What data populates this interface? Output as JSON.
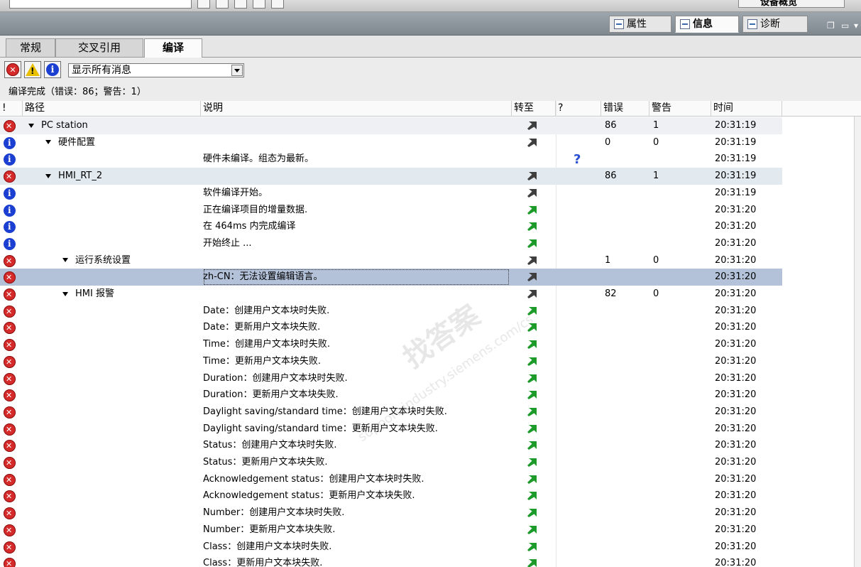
{
  "inspector": {
    "tabs": [
      {
        "label": "属性",
        "active": false
      },
      {
        "label": "信息",
        "active": true
      },
      {
        "label": "诊断",
        "active": false
      }
    ],
    "device_overview": "设备概览"
  },
  "subtabs": [
    {
      "label": "常规",
      "active": false
    },
    {
      "label": "交叉引用",
      "active": false
    },
    {
      "label": "编译",
      "active": true
    }
  ],
  "filter": {
    "selected": "显示所有消息"
  },
  "status": "编译完成（错误：86；警告：1）",
  "columns": {
    "bang": "!",
    "path": "路径",
    "description": "说明",
    "goto": "转至",
    "help": "?",
    "errors": "错误",
    "warnings": "警告",
    "time": "时间"
  },
  "rows": [
    {
      "sev": "error",
      "path": "PC station",
      "level": 1,
      "expand": true,
      "desc": "",
      "goto": "dark",
      "help": "",
      "errors": "86",
      "warnings": "1",
      "time": "20:31:19",
      "style": "lite"
    },
    {
      "sev": "info",
      "path": "硬件配置",
      "level": 2,
      "expand": true,
      "desc": "",
      "goto": "dark",
      "help": "",
      "errors": "0",
      "warnings": "0",
      "time": "20:31:19",
      "style": ""
    },
    {
      "sev": "info",
      "path": "",
      "level": 0,
      "expand": false,
      "desc": "硬件未编译。组态为最新。",
      "goto": "",
      "help": "?",
      "errors": "",
      "warnings": "",
      "time": "20:31:19",
      "style": ""
    },
    {
      "sev": "error",
      "path": "HMI_RT_2",
      "level": 2,
      "expand": true,
      "desc": "",
      "goto": "dark",
      "help": "",
      "errors": "86",
      "warnings": "1",
      "time": "20:31:19",
      "style": "hmi"
    },
    {
      "sev": "info",
      "path": "",
      "level": 0,
      "expand": false,
      "desc": "软件编译开始。",
      "goto": "dark",
      "help": "",
      "errors": "",
      "warnings": "",
      "time": "20:31:19",
      "style": ""
    },
    {
      "sev": "info",
      "path": "",
      "level": 0,
      "expand": false,
      "desc": "正在编译项目的增量数据.",
      "goto": "green",
      "help": "",
      "errors": "",
      "warnings": "",
      "time": "20:31:20",
      "style": ""
    },
    {
      "sev": "info",
      "path": "",
      "level": 0,
      "expand": false,
      "desc": "在 464ms 内完成编译",
      "goto": "green",
      "help": "",
      "errors": "",
      "warnings": "",
      "time": "20:31:20",
      "style": ""
    },
    {
      "sev": "info",
      "path": "",
      "level": 0,
      "expand": false,
      "desc": "开始终止 ...",
      "goto": "green",
      "help": "",
      "errors": "",
      "warnings": "",
      "time": "20:31:20",
      "style": ""
    },
    {
      "sev": "error",
      "path": "运行系统设置",
      "level": 3,
      "expand": true,
      "desc": "",
      "goto": "dark",
      "help": "",
      "errors": "1",
      "warnings": "0",
      "time": "20:31:20",
      "style": ""
    },
    {
      "sev": "error",
      "path": "",
      "level": 0,
      "expand": false,
      "desc": "zh-CN：无法设置编辑语言。",
      "goto": "dark",
      "help": "",
      "errors": "",
      "warnings": "",
      "time": "20:31:20",
      "style": "sel"
    },
    {
      "sev": "error",
      "path": "HMI 报警",
      "level": 3,
      "expand": true,
      "desc": "",
      "goto": "dark",
      "help": "",
      "errors": "82",
      "warnings": "0",
      "time": "20:31:20",
      "style": ""
    },
    {
      "sev": "error",
      "path": "",
      "level": 0,
      "expand": false,
      "desc": "Date：创建用户文本块时失败.",
      "goto": "green",
      "help": "",
      "errors": "",
      "warnings": "",
      "time": "20:31:20",
      "style": ""
    },
    {
      "sev": "error",
      "path": "",
      "level": 0,
      "expand": false,
      "desc": "Date：更新用户文本块失败.",
      "goto": "green",
      "help": "",
      "errors": "",
      "warnings": "",
      "time": "20:31:20",
      "style": ""
    },
    {
      "sev": "error",
      "path": "",
      "level": 0,
      "expand": false,
      "desc": "Time：创建用户文本块时失败.",
      "goto": "green",
      "help": "",
      "errors": "",
      "warnings": "",
      "time": "20:31:20",
      "style": ""
    },
    {
      "sev": "error",
      "path": "",
      "level": 0,
      "expand": false,
      "desc": "Time：更新用户文本块失败.",
      "goto": "green",
      "help": "",
      "errors": "",
      "warnings": "",
      "time": "20:31:20",
      "style": ""
    },
    {
      "sev": "error",
      "path": "",
      "level": 0,
      "expand": false,
      "desc": "Duration：创建用户文本块时失败.",
      "goto": "green",
      "help": "",
      "errors": "",
      "warnings": "",
      "time": "20:31:20",
      "style": ""
    },
    {
      "sev": "error",
      "path": "",
      "level": 0,
      "expand": false,
      "desc": "Duration：更新用户文本块失败.",
      "goto": "green",
      "help": "",
      "errors": "",
      "warnings": "",
      "time": "20:31:20",
      "style": ""
    },
    {
      "sev": "error",
      "path": "",
      "level": 0,
      "expand": false,
      "desc": "Daylight saving/standard time：创建用户文本块时失败.",
      "goto": "green",
      "help": "",
      "errors": "",
      "warnings": "",
      "time": "20:31:20",
      "style": ""
    },
    {
      "sev": "error",
      "path": "",
      "level": 0,
      "expand": false,
      "desc": "Daylight saving/standard time：更新用户文本块失败.",
      "goto": "green",
      "help": "",
      "errors": "",
      "warnings": "",
      "time": "20:31:20",
      "style": ""
    },
    {
      "sev": "error",
      "path": "",
      "level": 0,
      "expand": false,
      "desc": "Status：创建用户文本块时失败.",
      "goto": "green",
      "help": "",
      "errors": "",
      "warnings": "",
      "time": "20:31:20",
      "style": ""
    },
    {
      "sev": "error",
      "path": "",
      "level": 0,
      "expand": false,
      "desc": "Status：更新用户文本块失败.",
      "goto": "green",
      "help": "",
      "errors": "",
      "warnings": "",
      "time": "20:31:20",
      "style": ""
    },
    {
      "sev": "error",
      "path": "",
      "level": 0,
      "expand": false,
      "desc": "Acknowledgement status：创建用户文本块时失败.",
      "goto": "green",
      "help": "",
      "errors": "",
      "warnings": "",
      "time": "20:31:20",
      "style": ""
    },
    {
      "sev": "error",
      "path": "",
      "level": 0,
      "expand": false,
      "desc": "Acknowledgement status：更新用户文本块失败.",
      "goto": "green",
      "help": "",
      "errors": "",
      "warnings": "",
      "time": "20:31:20",
      "style": ""
    },
    {
      "sev": "error",
      "path": "",
      "level": 0,
      "expand": false,
      "desc": "Number：创建用户文本块时失败.",
      "goto": "green",
      "help": "",
      "errors": "",
      "warnings": "",
      "time": "20:31:20",
      "style": ""
    },
    {
      "sev": "error",
      "path": "",
      "level": 0,
      "expand": false,
      "desc": "Number：更新用户文本块失败.",
      "goto": "green",
      "help": "",
      "errors": "",
      "warnings": "",
      "time": "20:31:20",
      "style": ""
    },
    {
      "sev": "error",
      "path": "",
      "level": 0,
      "expand": false,
      "desc": "Class：创建用户文本块时失败.",
      "goto": "green",
      "help": "",
      "errors": "",
      "warnings": "",
      "time": "20:31:20",
      "style": ""
    },
    {
      "sev": "error",
      "path": "",
      "level": 0,
      "expand": false,
      "desc": "Class：更新用户文本块失败.",
      "goto": "green",
      "help": "",
      "errors": "",
      "warnings": "",
      "time": "20:31:20",
      "style": ""
    }
  ],
  "watermark": {
    "text1": "找答案",
    "text2": "support.industry.siemens.com/cs"
  }
}
